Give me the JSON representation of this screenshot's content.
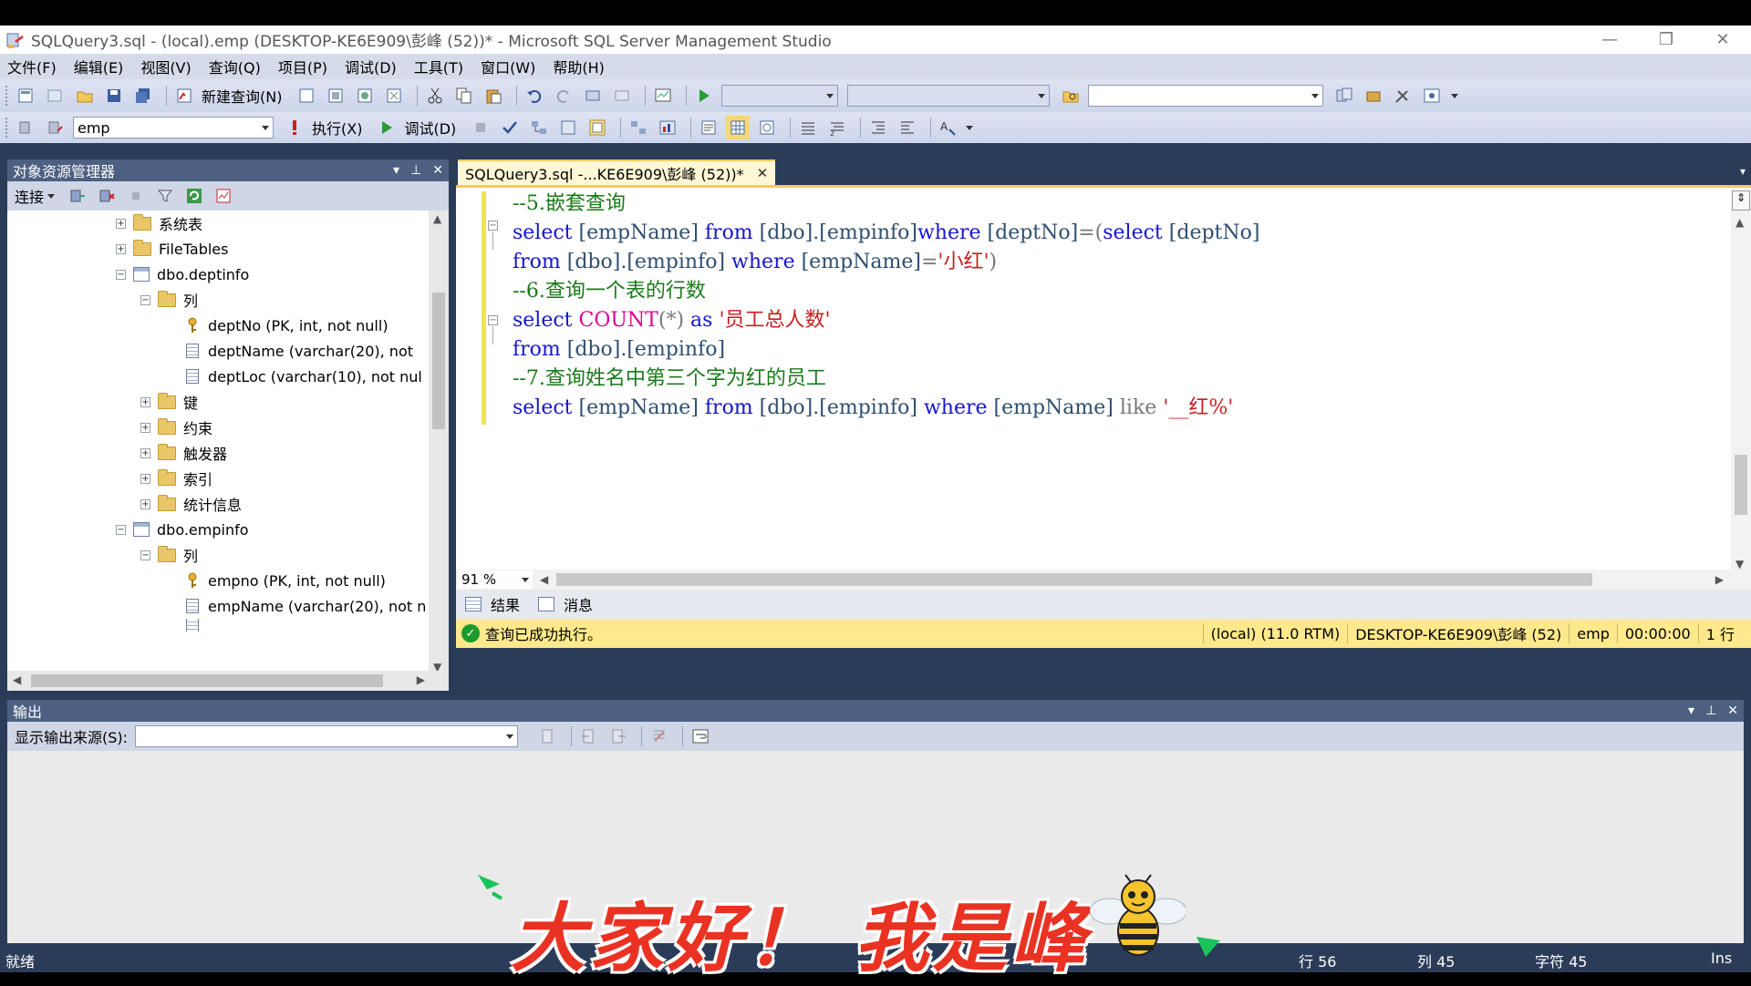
{
  "window": {
    "title": "SQLQuery3.sql - (local).emp (DESKTOP-KE6E909\\彭峰 (52))* - Microsoft SQL Server Management Studio"
  },
  "menu": [
    "文件(F)",
    "编辑(E)",
    "视图(V)",
    "查询(Q)",
    "项目(P)",
    "调试(D)",
    "工具(T)",
    "窗口(W)",
    "帮助(H)"
  ],
  "toolbar": {
    "new_query": "新建查询(N)",
    "database": "emp",
    "execute": "执行(X)",
    "debug": "调试(D)"
  },
  "object_explorer": {
    "title": "对象资源管理器",
    "connect": "连接",
    "nodes": [
      {
        "label": "系统表"
      },
      {
        "label": "FileTables"
      },
      {
        "label": "dbo.deptinfo"
      },
      {
        "label": "列"
      },
      {
        "label": "deptNo (PK, int, not null)"
      },
      {
        "label": "deptName (varchar(20), not"
      },
      {
        "label": "deptLoc (varchar(10), not nul"
      },
      {
        "label": "键"
      },
      {
        "label": "约束"
      },
      {
        "label": "触发器"
      },
      {
        "label": "索引"
      },
      {
        "label": "统计信息"
      },
      {
        "label": "dbo.empinfo"
      },
      {
        "label": "列"
      },
      {
        "label": "empno (PK, int, not null)"
      },
      {
        "label": "empName (varchar(20), not n"
      }
    ]
  },
  "editor": {
    "tab_label": "SQLQuery3.sql -...KE6E909\\彭峰 (52))*",
    "zoom": "91 %",
    "lines": {
      "l1": "--5.嵌套查询",
      "l2_kw1": "select",
      "l2_id1": " [empName] ",
      "l2_kw2": "from",
      "l2_id2": " [dbo].[empinfo]",
      "l2_kw3": "where",
      "l2_id3": " [deptNo]",
      "l2_op": "=(",
      "l2_kw4": "select",
      "l2_id4": " [deptNo]",
      "l3_kw1": "from",
      "l3_id1": " [dbo].[empinfo] ",
      "l3_kw2": "where",
      "l3_id2": " [empName]",
      "l3_op": "=",
      "l3_st": "'小红'",
      "l3_op2": ")",
      "l4": "--6.查询一个表的行数",
      "l5_kw1": "select",
      "l5_fn": " COUNT",
      "l5_op": "(*)",
      "l5_kw2": " as ",
      "l5_st": "'员工总人数'",
      "l6_kw1": "from",
      "l6_id1": " [dbo].[empinfo]",
      "l7": "--7.查询姓名中第三个字为红的员工",
      "l8_kw1": "select",
      "l8_id1": " [empName] ",
      "l8_kw2": "from",
      "l8_id2": " [dbo].[empinfo] ",
      "l8_kw3": "where",
      "l8_id3": " [empName] ",
      "l8_op": "like ",
      "l8_st": "'__红%'"
    }
  },
  "results": {
    "tab_results": "结果",
    "tab_messages": "消息"
  },
  "query_status": {
    "message": "查询已成功执行。",
    "server": "(local) (11.0 RTM)",
    "user": "DESKTOP-KE6E909\\彭峰 (52)",
    "database": "emp",
    "time": "00:00:00",
    "rows": "1 行"
  },
  "output": {
    "title": "输出",
    "source_label": "显示输出来源(S):"
  },
  "statusbar": {
    "ready": "就绪",
    "line": "行 56",
    "col": "列 45",
    "char": "字符 45",
    "mode": "Ins"
  },
  "overlay": {
    "caption": "大家好！ 我是峰"
  },
  "colors": {
    "keyword": "#1515d0",
    "comment": "#1a7a1a",
    "string": "#c71e1e",
    "function": "#e0008b",
    "chrome": "#2b3c59"
  }
}
